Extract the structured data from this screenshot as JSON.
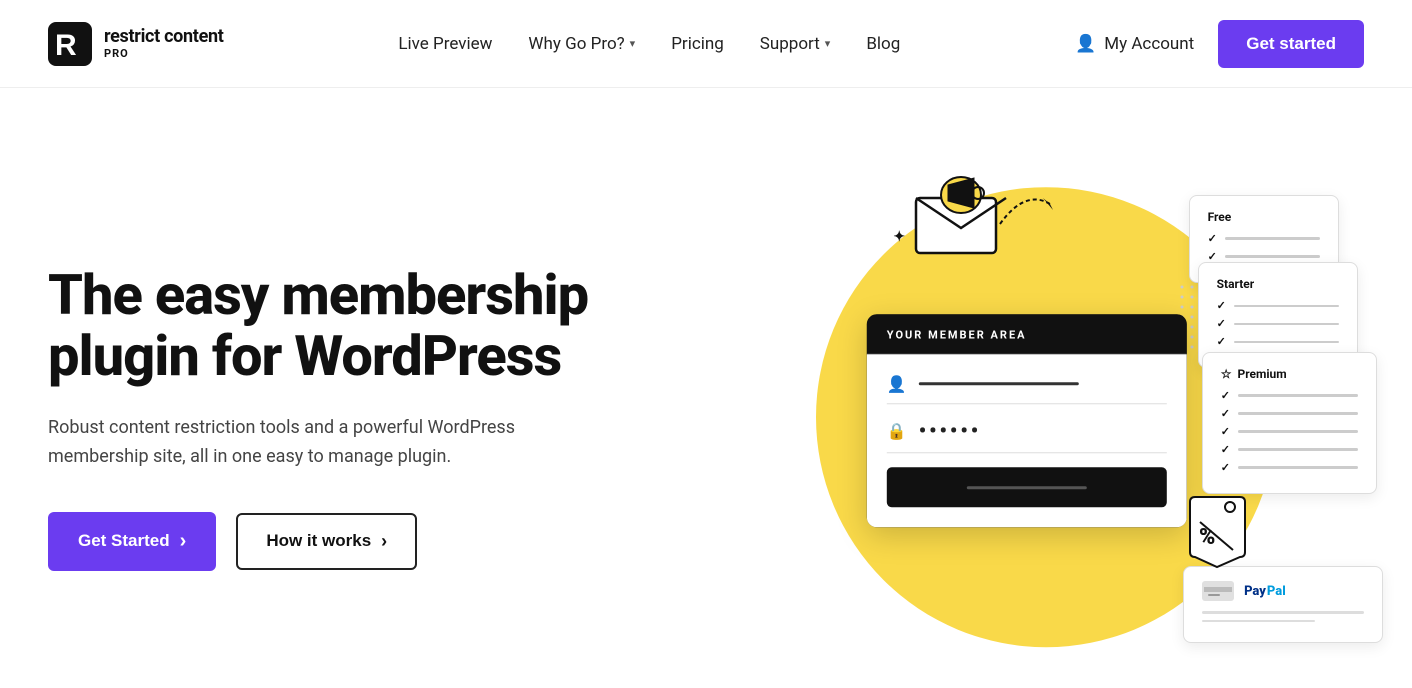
{
  "site": {
    "logo_r": "R",
    "logo_name": "restrict content",
    "logo_pro": "PRO"
  },
  "nav": {
    "items": [
      {
        "label": "Live Preview",
        "has_dropdown": false
      },
      {
        "label": "Why Go Pro?",
        "has_dropdown": true
      },
      {
        "label": "Pricing",
        "has_dropdown": false
      },
      {
        "label": "Support",
        "has_dropdown": true
      },
      {
        "label": "Blog",
        "has_dropdown": false
      }
    ],
    "my_account": "My Account",
    "get_started": "Get started"
  },
  "hero": {
    "title": "The easy membership plugin for WordPress",
    "subtitle": "Robust content restriction tools and a powerful WordPress membership site, all in one easy to manage plugin.",
    "btn_primary": "Get Started",
    "btn_primary_arrow": "›",
    "btn_secondary": "How it works",
    "btn_secondary_arrow": "›"
  },
  "illustration": {
    "member_area_label": "YOUR MEMBER AREA",
    "member_field_password_dots": "••••••",
    "cards": [
      {
        "id": "free",
        "label": "Free",
        "rows": 2
      },
      {
        "id": "starter",
        "label": "Starter",
        "rows": 3
      },
      {
        "id": "premium",
        "label": "Premium",
        "rows": 5
      }
    ],
    "paypal_text": "PayPal"
  },
  "colors": {
    "primary": "#6b3cf0",
    "yellow": "#f9d949",
    "dark": "#111111"
  }
}
